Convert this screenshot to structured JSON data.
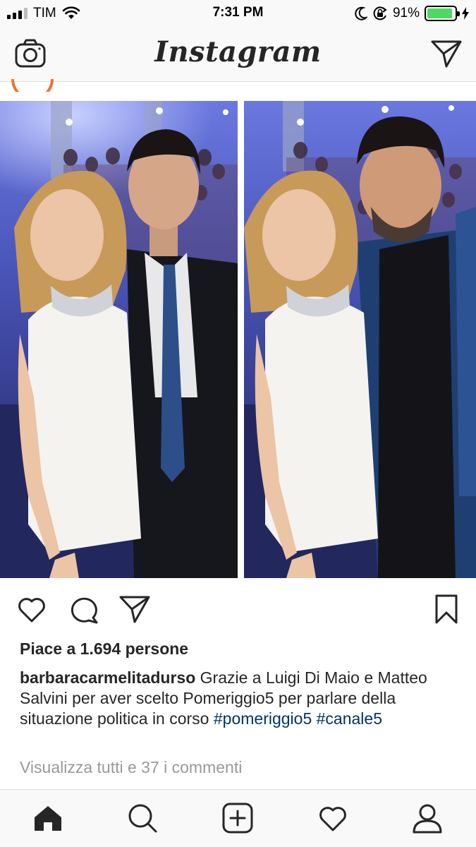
{
  "status_bar": {
    "carrier": "TIM",
    "time": "7:31 PM",
    "battery_percent": "91%",
    "battery_level": 0.91,
    "icons": [
      "signal-icon",
      "wifi-icon",
      "moon-icon",
      "orientation-lock-icon",
      "battery-icon",
      "charging-icon"
    ]
  },
  "header": {
    "title": "Instagram",
    "left_icon": "camera-icon",
    "right_icon": "direct-send-icon"
  },
  "post": {
    "images": [
      "photo-left",
      "photo-right"
    ],
    "actions": [
      "heart-icon",
      "comment-icon",
      "share-icon",
      "bookmark-icon"
    ],
    "likes_text": "Piace a 1.694 persone",
    "caption": {
      "username": "barbaracarmelitadurso",
      "text": " Grazie a Luigi Di Maio e Matteo Salvini per aver scelto Pomeriggio5 per parlare della situazione politica in corso ",
      "hashtag_1": "#pomeriggio5",
      "hashtag_2": "#canale5"
    },
    "view_comments": "Visualizza tutti e 37 i commenti"
  },
  "tab_bar": {
    "tabs": [
      "home-icon",
      "search-icon",
      "add-post-icon",
      "activity-icon",
      "profile-icon"
    ]
  },
  "colors": {
    "hashtag": "#003569",
    "battery": "#4cd964",
    "muted_text": "#999999",
    "bar_background": "#f9f9f9"
  }
}
